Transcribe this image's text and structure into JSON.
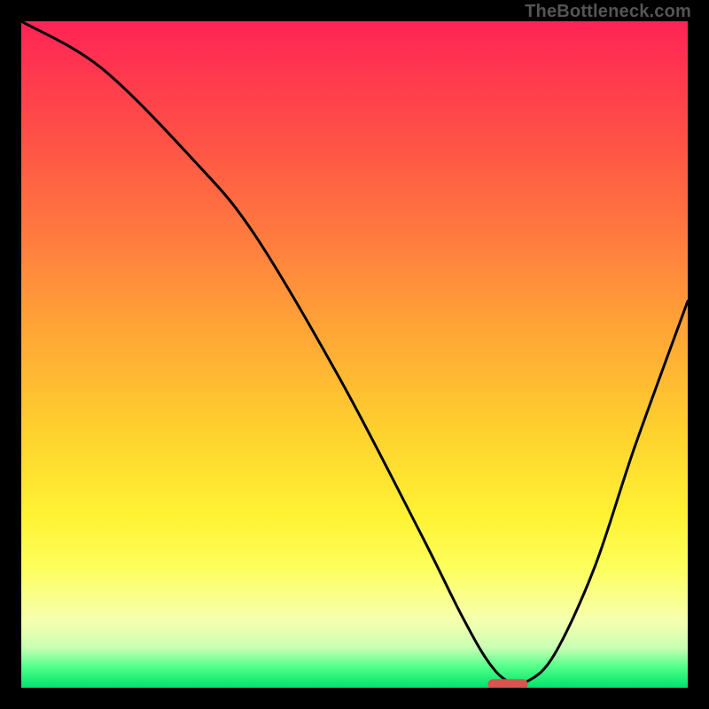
{
  "watermark": "TheBottleneck.com",
  "colors": {
    "page_bg": "#000000",
    "curve_stroke": "#000000",
    "marker_fill": "#d9534f",
    "gradient_top": "#ff2356",
    "gradient_mid": "#ffd22e",
    "gradient_bottom": "#00e26b"
  },
  "chart_data": {
    "type": "line",
    "title": "",
    "xlabel": "",
    "ylabel": "",
    "xlim": [
      0,
      100
    ],
    "ylim": [
      0,
      100
    ],
    "series": [
      {
        "name": "bottleneck-curve",
        "x": [
          0,
          12,
          26,
          35,
          48,
          60,
          66,
          70,
          73,
          76,
          80,
          86,
          92,
          100
        ],
        "values": [
          100,
          93,
          79,
          68,
          46,
          23,
          11,
          4,
          1,
          1,
          5,
          18,
          36,
          58
        ]
      }
    ],
    "marker": {
      "x_start": 70,
      "x_end": 76,
      "y": 0.5
    },
    "annotations": []
  }
}
